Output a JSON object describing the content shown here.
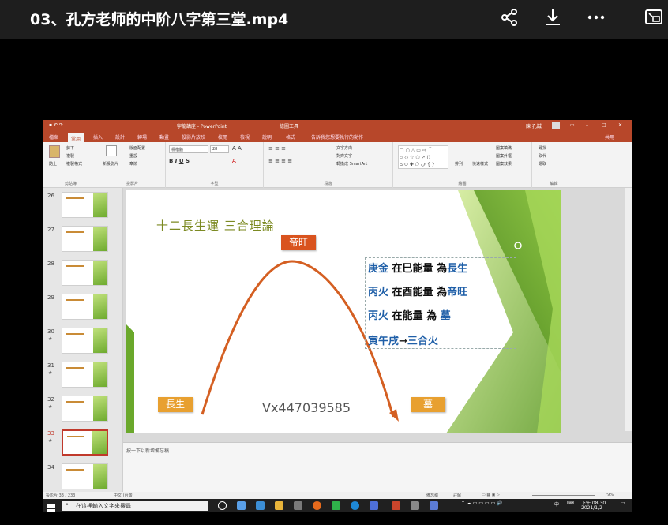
{
  "player": {
    "title": "03、孔方老师的中阶八字第三堂.mp4",
    "share_icon": "share-icon",
    "download_icon": "download-icon",
    "more_icon": "more-icon",
    "pip_icon": "picture-in-picture-icon"
  },
  "ppt": {
    "window_title": "宇龍講座 - PowerPoint",
    "tool_title": "繪圖工具",
    "user_name": "陳 孔誠",
    "share_label": "共用",
    "tabs": [
      "檔案",
      "常用",
      "插入",
      "設計",
      "轉場",
      "動畫",
      "投影片放映",
      "校閱",
      "檢視",
      "說明",
      "格式"
    ],
    "tell_me": "告訴我您想要執行的動作",
    "ribbon": {
      "paste": "貼上",
      "new_slide": "新投影片",
      "font_name": "標楷體",
      "font_size": "28",
      "text_direction": "文字方向",
      "align_text": "對齊文字",
      "smartart": "轉換成 SmartArt",
      "arrange": "排列",
      "quick_styles": "快速樣式",
      "find": "尋找",
      "replace": "取代",
      "select": "選取",
      "shape_fill": "圖案填滿",
      "shape_outline": "圖案外框",
      "shape_effects": "圖案效果",
      "cut": "剪下",
      "copy": "複製",
      "format_painter": "複製格式",
      "layout": "版面配置",
      "reset": "重設",
      "section": "章節",
      "groups": [
        "剪貼簿",
        "投影片",
        "字型",
        "段落",
        "繪圖",
        "編輯"
      ]
    },
    "thumbnails": [
      "26",
      "27",
      "28",
      "29",
      "30",
      "31",
      "32",
      "33",
      "34"
    ],
    "selected_slide": "33",
    "slide": {
      "title": "十二長生運 三合理論",
      "peak_label": "帝旺",
      "start_label": "長生",
      "end_label": "墓",
      "watermark": "Vx447039585",
      "lines": [
        {
          "a": "庚金",
          "b": "在巳能量",
          "c": "為",
          "d": "長生"
        },
        {
          "a": "丙火",
          "b": "在酉能量",
          "c": "為",
          "d": "帝旺"
        },
        {
          "a": "丙火",
          "b": "在能量",
          "c": "為",
          "d": "墓"
        },
        {
          "a": "寅午戌",
          "b": "→",
          "c": "",
          "d": "三合火"
        }
      ]
    },
    "notes_placeholder": "按一下以新增備忘稿",
    "status": {
      "slide_info": "投影片 33 / 233",
      "language": "中文 (台灣)",
      "notes_btn": "備忘稿",
      "comments_btn": "註解",
      "zoom": "79%"
    }
  },
  "taskbar": {
    "search_placeholder": "在這裡輸入文字來搜尋",
    "ime": "中",
    "time": "下午 08:30",
    "date": "2021/1/2"
  },
  "colors": {
    "ppt_red": "#b7472a",
    "slide_title": "#7c8a22",
    "curve": "#d45f22",
    "label_orange": "#e8a030",
    "text_blue": "#1f5fa8"
  }
}
